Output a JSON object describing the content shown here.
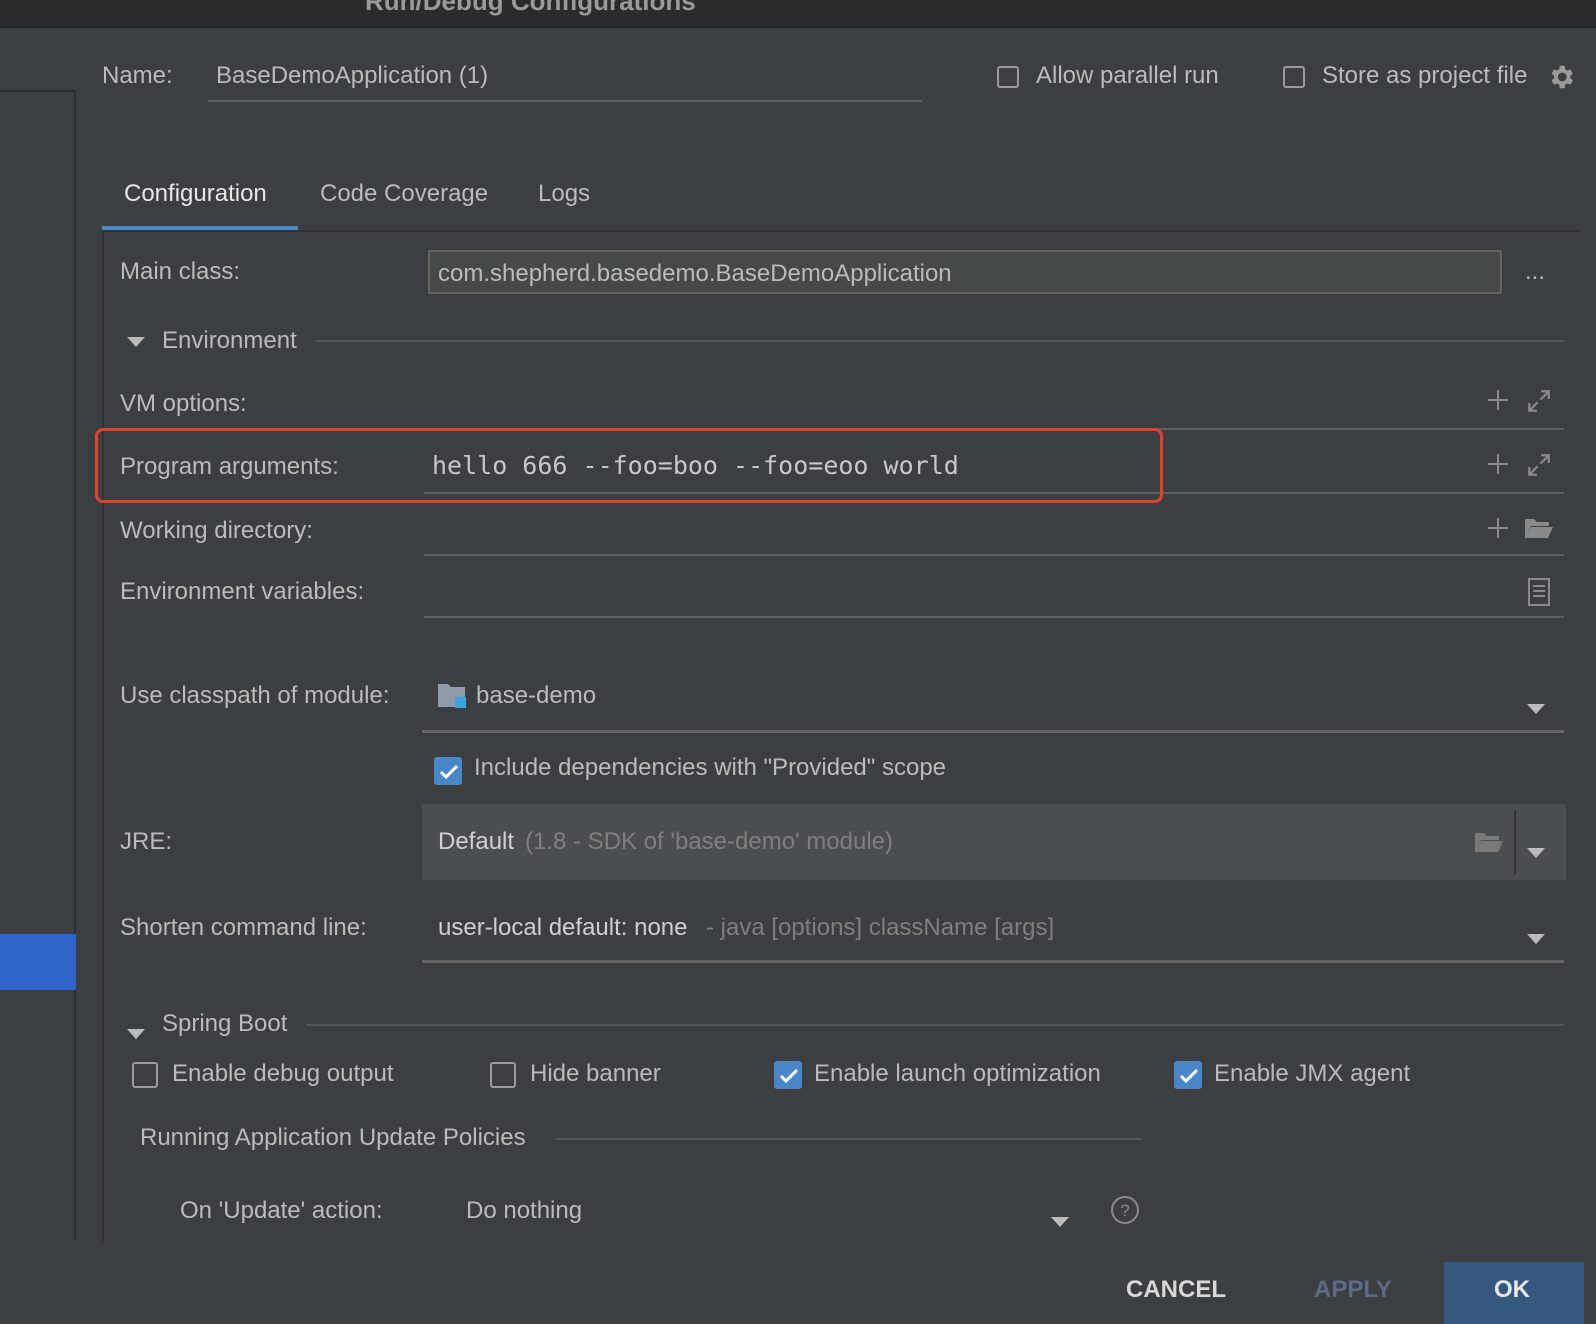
{
  "window": {
    "title": "Run/Debug Configurations"
  },
  "header": {
    "name_label": "Name:",
    "name_value": "BaseDemoApplication (1)",
    "allow_parallel_label": "Allow parallel run",
    "allow_parallel_checked": false,
    "store_project_label": "Store as project file",
    "store_project_checked": false
  },
  "tabs": [
    {
      "label": "Configuration",
      "active": true
    },
    {
      "label": "Code Coverage",
      "active": false
    },
    {
      "label": "Logs",
      "active": false
    }
  ],
  "main_class": {
    "label": "Main class:",
    "value": "com.shepherd.basedemo.BaseDemoApplication",
    "browse": "..."
  },
  "environment": {
    "section_label": "Environment",
    "vm_options_label": "VM options:",
    "vm_options_value": "",
    "program_args_label": "Program arguments:",
    "program_args_value": "hello 666 --foo=boo --foo=eoo world",
    "working_dir_label": "Working directory:",
    "working_dir_value": "",
    "env_vars_label": "Environment variables:",
    "env_vars_value": ""
  },
  "classpath": {
    "label": "Use classpath of module:",
    "module": "base-demo",
    "include_provided_label": "Include dependencies with \"Provided\" scope",
    "include_provided_checked": true
  },
  "jre": {
    "label": "JRE:",
    "value": "Default",
    "detail": "(1.8 - SDK of 'base-demo' module)"
  },
  "shorten": {
    "label": "Shorten command line:",
    "value": "user-local default: none",
    "detail": "- java [options] className [args]"
  },
  "spring_boot": {
    "section_label": "Spring Boot",
    "enable_debug_label": "Enable debug output",
    "enable_debug_checked": false,
    "hide_banner_label": "Hide banner",
    "hide_banner_checked": false,
    "launch_opt_label": "Enable launch optimization",
    "launch_opt_checked": true,
    "jmx_label": "Enable JMX agent",
    "jmx_checked": true,
    "update_policies_label": "Running Application Update Policies",
    "on_update_label": "On 'Update' action:",
    "on_update_value": "Do nothing"
  },
  "footer": {
    "cancel": "CANCEL",
    "apply": "APPLY",
    "ok": "OK"
  },
  "colors": {
    "background": "#3c3f41",
    "accent": "#4a87c9",
    "ok_button": "#365880",
    "highlight_box": "#e0412e"
  }
}
